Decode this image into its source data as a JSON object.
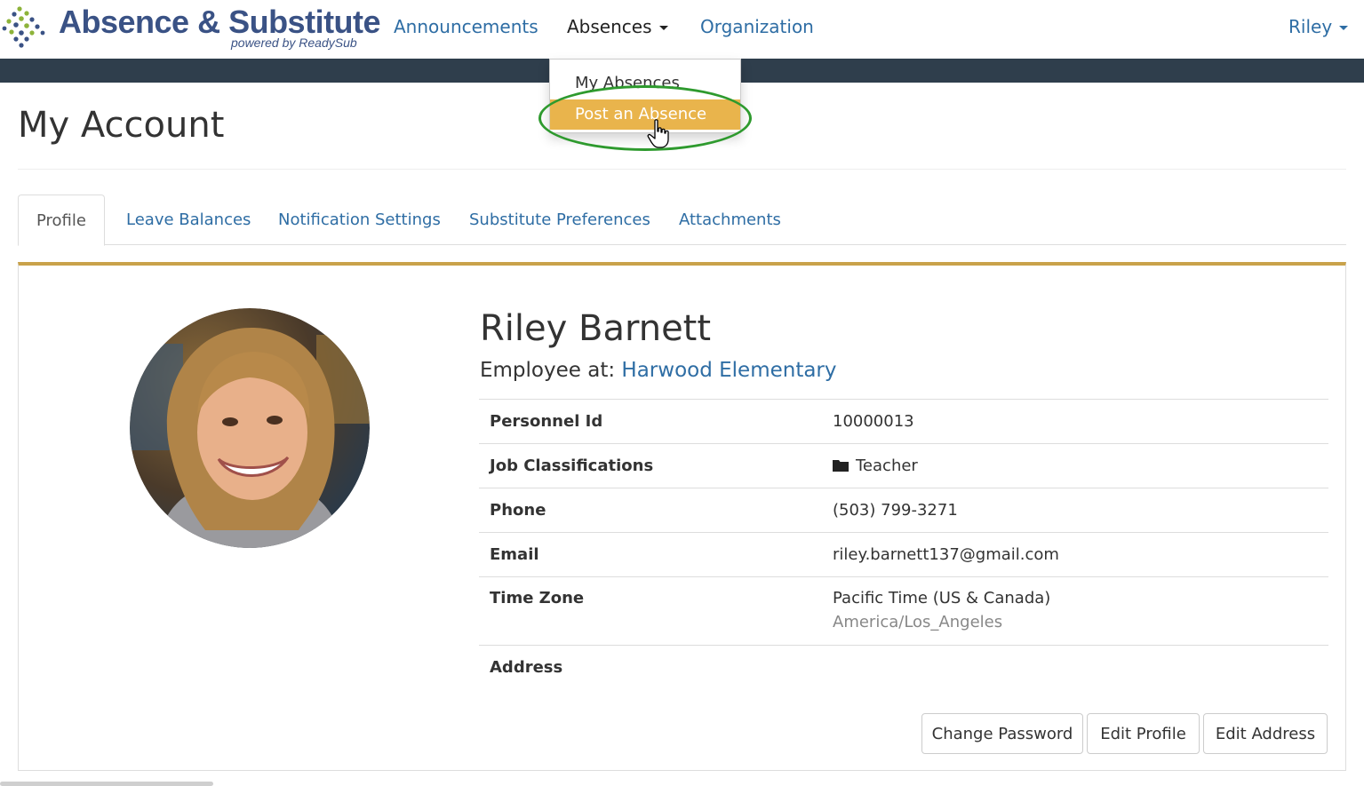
{
  "brand": {
    "title": "Absence & Substitute",
    "subtitle": "powered by ReadySub"
  },
  "nav": {
    "announcements": "Announcements",
    "absences": "Absences",
    "organization": "Organization",
    "user": "Riley"
  },
  "dropdown": {
    "items": [
      "My Absences",
      "Post an Absence"
    ],
    "highlighted": "Post an Absence"
  },
  "page": {
    "title": "My Account"
  },
  "tabs": [
    "Profile",
    "Leave Balances",
    "Notification Settings",
    "Substitute Preferences",
    "Attachments"
  ],
  "profile": {
    "name": "Riley Barnett",
    "employee_label": "Employee at:",
    "school": "Harwood Elementary",
    "rows": [
      {
        "label": "Personnel Id",
        "value": "10000013"
      },
      {
        "label": "Job Classifications",
        "value": "Teacher",
        "icon": "folder-icon"
      },
      {
        "label": "Phone",
        "value": "(503) 799-3271"
      },
      {
        "label": "Email",
        "value": "riley.barnett137@gmail.com"
      },
      {
        "label": "Time Zone",
        "value": "Pacific Time (US & Canada)",
        "sub": "America/Los_Angeles"
      },
      {
        "label": "Address",
        "value": ""
      }
    ]
  },
  "buttons": {
    "change_password": "Change Password",
    "edit_profile": "Edit Profile",
    "edit_address": "Edit Address"
  },
  "colors": {
    "link": "#2e6da4",
    "navbar_band": "#2f3e4c",
    "highlight": "#e9b44c",
    "panel_accent": "#c9a24a",
    "ring": "#2e9a2e"
  }
}
